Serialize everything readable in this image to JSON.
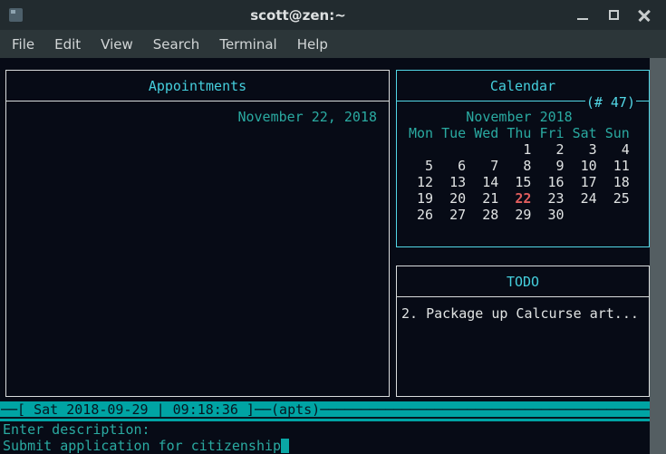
{
  "window": {
    "title": "scott@zen:~"
  },
  "menu": {
    "items": [
      "File",
      "Edit",
      "View",
      "Search",
      "Terminal",
      "Help"
    ]
  },
  "panels": {
    "appointments": {
      "title": "Appointments",
      "date_header": "November 22, 2018"
    },
    "calendar": {
      "title": "Calendar",
      "week_badge": "(# 47)",
      "month": "November 2018",
      "weekdays": "Mon Tue Wed Thu Fri Sat Sun",
      "today": "22",
      "weeks": [
        [
          "",
          "",
          "",
          "1",
          "2",
          "3",
          "4"
        ],
        [
          "5",
          "6",
          "7",
          "8",
          "9",
          "10",
          "11"
        ],
        [
          "12",
          "13",
          "14",
          "15",
          "16",
          "17",
          "18"
        ],
        [
          "19",
          "20",
          "21",
          "22",
          "23",
          "24",
          "25"
        ],
        [
          "26",
          "27",
          "28",
          "29",
          "30",
          "",
          ""
        ]
      ]
    },
    "todo": {
      "title": "TODO",
      "items": [
        "2. Package up Calcurse art..."
      ]
    }
  },
  "statusbar": {
    "date": "Sat 2018-09-29",
    "time": "09:18:36",
    "panel_mode": "apts",
    "line": "──[ Sat 2018-09-29 | 09:18:36 ]──(apts)──────────────────────────────────────────────────"
  },
  "prompt": {
    "label": "Enter description:",
    "input": "Submit application for citizenship"
  },
  "colors": {
    "terminal_bg": "#070b16",
    "titlebar_bg": "#222b2f",
    "menubar_bg": "#2c3639",
    "teal_text": "#2aaaa1",
    "cyan_border": "#52d7e6",
    "white_text": "#e0e3e3",
    "today_red": "#e05d5d",
    "statusbar_bg": "#00a4a4",
    "panel_border": "#d9dcdd",
    "scrollbar": "#545e62"
  }
}
